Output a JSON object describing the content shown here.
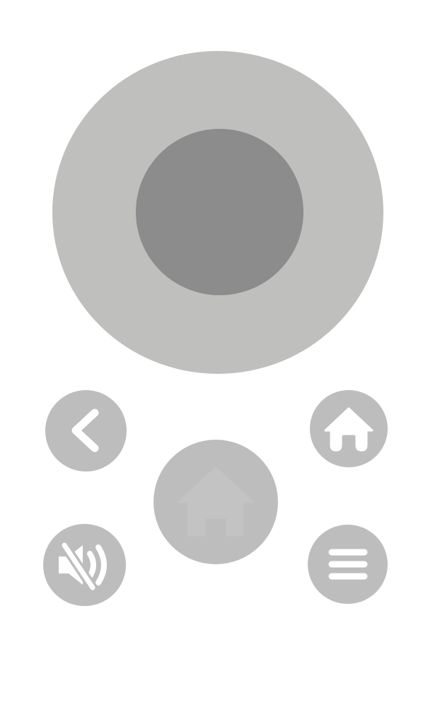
{
  "remote": {
    "dpad": {
      "outer_icon": "dpad-ring",
      "center_icon": "ok-button"
    },
    "buttons": {
      "back": {
        "icon": "chevron-left-icon"
      },
      "home": {
        "icon": "home-icon"
      },
      "mute": {
        "icon": "volume-mute-icon"
      },
      "menu": {
        "icon": "menu-icon"
      },
      "center_home": {
        "icon": "home-icon"
      }
    }
  },
  "colors": {
    "background": "#ffffff",
    "dpad_ring": "#bfbfbe",
    "dpad_center": "#8c8c8c",
    "button": "#bdbdbd",
    "icon": "#ffffff",
    "faint_icon": "#c6c6c6"
  }
}
